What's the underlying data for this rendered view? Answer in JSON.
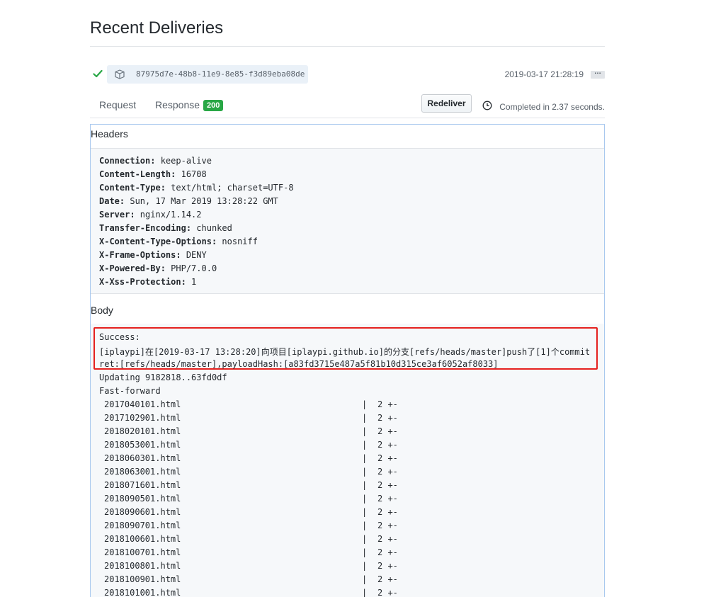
{
  "page": {
    "title": "Recent Deliveries"
  },
  "delivery": {
    "guid": "87975d7e-48b8-11e9-8e85-f3d89eba08de",
    "timestamp": "2019-03-17 21:28:19",
    "more_label": "…",
    "status_icon": "check-icon",
    "status_color": "#28a745"
  },
  "tabs": {
    "request_label": "Request",
    "response_label": "Response",
    "response_status": "200",
    "redeliver_label": "Redeliver",
    "completed_text": "Completed in 2.37 seconds."
  },
  "headers": {
    "title": "Headers",
    "items": [
      {
        "key": "Connection:",
        "value": "keep-alive"
      },
      {
        "key": "Content-Length:",
        "value": "16708"
      },
      {
        "key": "Content-Type:",
        "value": "text/html; charset=UTF-8"
      },
      {
        "key": "Date:",
        "value": "Sun, 17 Mar 2019 13:28:22 GMT"
      },
      {
        "key": "Server:",
        "value": "nginx/1.14.2"
      },
      {
        "key": "Transfer-Encoding:",
        "value": "chunked"
      },
      {
        "key": "X-Content-Type-Options:",
        "value": "nosniff"
      },
      {
        "key": "X-Frame-Options:",
        "value": "DENY"
      },
      {
        "key": "X-Powered-By:",
        "value": "PHP/7.0.0"
      },
      {
        "key": "X-Xss-Protection:",
        "value": "1"
      }
    ]
  },
  "body": {
    "title": "Body",
    "lines": [
      "Success:",
      "[iplaypi]在[2019-03-17 13:28:20]向项目[iplaypi.github.io]的分支[refs/heads/master]push了[1]个commit",
      "ret:[refs/heads/master],payloadHash:[a83fd3715e487a5f81b10d315ce3af6052af8033]",
      "Updating 9182818..63fd0df",
      "Fast-forward"
    ],
    "files": [
      {
        "name": "2017040101.html",
        "sep": "|",
        "change": "2 +-"
      },
      {
        "name": "2017102901.html",
        "sep": "|",
        "change": "2 +-"
      },
      {
        "name": "2018020101.html",
        "sep": "|",
        "change": "2 +-"
      },
      {
        "name": "2018053001.html",
        "sep": "|",
        "change": "2 +-"
      },
      {
        "name": "2018060301.html",
        "sep": "|",
        "change": "2 +-"
      },
      {
        "name": "2018063001.html",
        "sep": "|",
        "change": "2 +-"
      },
      {
        "name": "2018071601.html",
        "sep": "|",
        "change": "2 +-"
      },
      {
        "name": "2018090501.html",
        "sep": "|",
        "change": "2 +-"
      },
      {
        "name": "2018090601.html",
        "sep": "|",
        "change": "2 +-"
      },
      {
        "name": "2018090701.html",
        "sep": "|",
        "change": "2 +-"
      },
      {
        "name": "2018100601.html",
        "sep": "|",
        "change": "2 +-"
      },
      {
        "name": "2018100701.html",
        "sep": "|",
        "change": "2 +-"
      },
      {
        "name": "2018100801.html",
        "sep": "|",
        "change": "2 +-"
      },
      {
        "name": "2018100901.html",
        "sep": "|",
        "change": "2 +-"
      },
      {
        "name": "2018101001.html",
        "sep": "|",
        "change": "2 +-"
      }
    ]
  },
  "colors": {
    "highlight_border": "#e5211f",
    "panel_border": "#a8c8ee",
    "badge": "#28a745"
  }
}
